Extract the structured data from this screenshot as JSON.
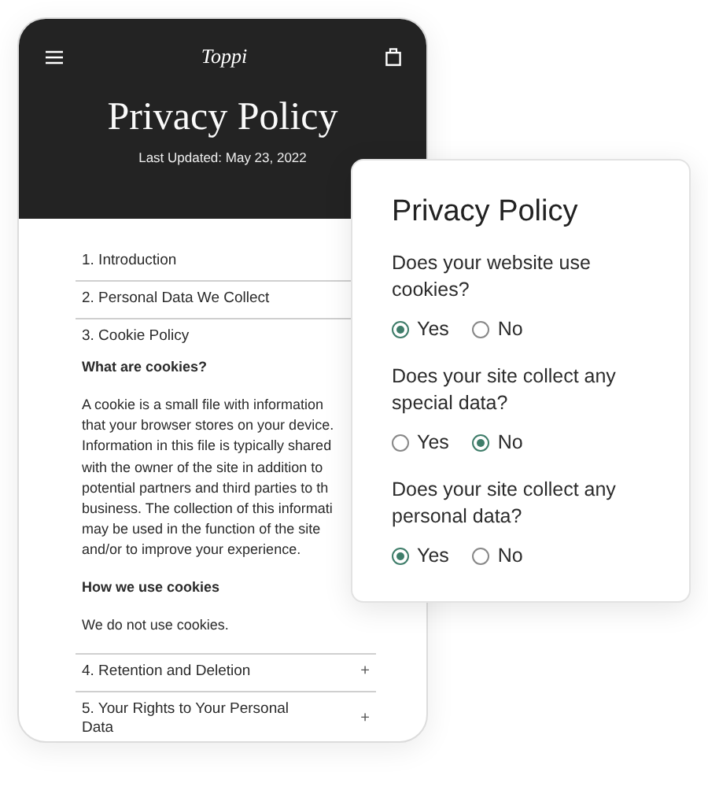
{
  "header": {
    "logo": "Toppi",
    "title": "Privacy Policy",
    "updated": "Last Updated: May 23, 2022"
  },
  "sections": [
    {
      "label": "1. Introduction"
    },
    {
      "label": "2. Personal Data We Collect"
    },
    {
      "label": "3. Cookie Policy",
      "content": [
        {
          "kind": "heading",
          "text": "What are cookies?"
        },
        {
          "kind": "paragraph",
          "lines": [
            "A cookie is a small file with information",
            "that your browser stores on your device.",
            "Information in this file is typically shared",
            "with the owner of the site in addition to",
            "potential partners and third parties to th",
            "business. The collection of this informati",
            "may be used in the function of the site",
            "and/or to improve your experience."
          ]
        },
        {
          "kind": "heading",
          "text": "How we use cookies"
        },
        {
          "kind": "paragraph",
          "lines": [
            "We do not use cookies."
          ]
        }
      ]
    },
    {
      "label": "4. Retention and Deletion",
      "toggle": "+"
    },
    {
      "label": "5. Your Rights to Your Personal Data",
      "toggle": "+"
    }
  ],
  "card": {
    "title": "Privacy Policy",
    "questions": [
      {
        "text": "Does your website use cookies?",
        "options": [
          {
            "label": "Yes",
            "selected": true
          },
          {
            "label": "No",
            "selected": false
          }
        ]
      },
      {
        "text": "Does your site collect any special data?",
        "options": [
          {
            "label": "Yes",
            "selected": false
          },
          {
            "label": "No",
            "selected": true
          }
        ]
      },
      {
        "text": "Does your site collect any personal data?",
        "options": [
          {
            "label": "Yes",
            "selected": true
          },
          {
            "label": "No",
            "selected": false
          }
        ]
      }
    ]
  }
}
